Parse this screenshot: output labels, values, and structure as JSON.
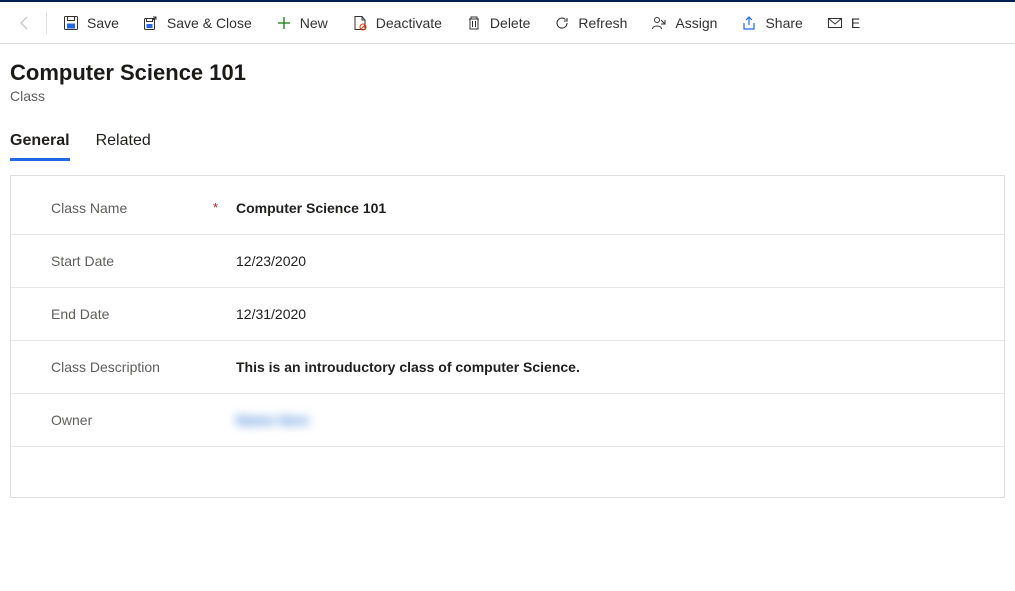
{
  "toolbar": {
    "save": "Save",
    "save_close": "Save & Close",
    "new": "New",
    "deactivate": "Deactivate",
    "delete": "Delete",
    "refresh": "Refresh",
    "assign": "Assign",
    "share": "Share",
    "email": "E"
  },
  "header": {
    "title": "Computer Science 101",
    "entity": "Class"
  },
  "tabs": {
    "general": "General",
    "related": "Related"
  },
  "form": {
    "class_name_label": "Class Name",
    "class_name_value": "Computer Science 101",
    "start_date_label": "Start Date",
    "start_date_value": "12/23/2020",
    "end_date_label": "End Date",
    "end_date_value": "12/31/2020",
    "description_label": "Class Description",
    "description_value": "This is an introuductory class of computer Science.",
    "owner_label": "Owner",
    "owner_value": "Name Here"
  }
}
